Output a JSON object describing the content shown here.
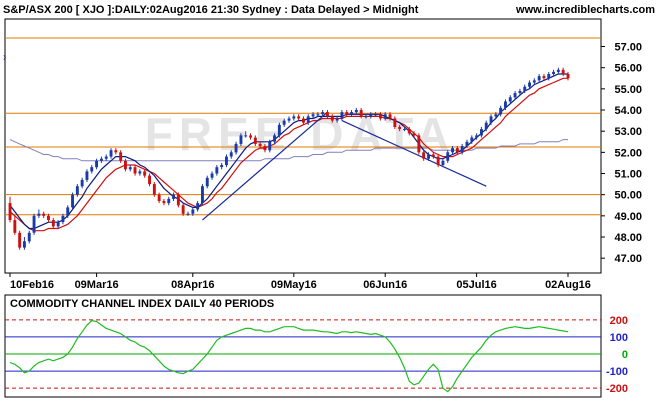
{
  "header": {
    "title": "S&P/ASX 200 [ XJO ]:DAILY:02Aug2016 21:30 Sydney : Data Delayed > Midnight",
    "site": "www.incrediblecharts.com",
    "watermark": "FREE DATA"
  },
  "colors": {
    "up_candle": "#1a3aaa",
    "down_candle": "#cc1111",
    "ma_short": "#0a1a80",
    "ma_medium": "#d01010",
    "ma_long": "#8080c0",
    "support_resistance": "#e07800",
    "trendline": "#1a2a99",
    "cci_line": "#22bb22",
    "cci_ref": "#2222cc",
    "cci_extreme": "#cc1111",
    "cci_zero": "#00aa00"
  },
  "chart_data": [
    {
      "type": "candlestick",
      "ylim": [
        46.3,
        58.3
      ],
      "yticks": [
        "47.00",
        "48.00",
        "49.00",
        "50.00",
        "51.00",
        "52.00",
        "53.00",
        "54.00",
        "55.00",
        "56.00",
        "57.00"
      ],
      "xlabels": [
        "10Feb16",
        "09Mar16",
        "08Apr16",
        "09May16",
        "06Jun16",
        "05Jul16",
        "02Aug16"
      ],
      "xlabel_index": [
        0,
        18,
        38,
        59,
        78,
        97,
        116
      ],
      "horizontal_lines": [
        57.4,
        53.85,
        52.25,
        50.0,
        49.05
      ],
      "trendlines": [
        {
          "from": [
            40,
            48.8
          ],
          "to": [
            66,
            53.9
          ]
        },
        {
          "from": [
            69,
            53.5
          ],
          "to": [
            99,
            50.4
          ]
        }
      ],
      "open": [
        49.6,
        48.8,
        48.2,
        47.5,
        47.8,
        48.2,
        49.0,
        49.1,
        49.0,
        48.8,
        48.5,
        48.7,
        49.0,
        49.4,
        50.0,
        50.4,
        50.7,
        51.1,
        51.3,
        51.6,
        51.7,
        51.8,
        52.1,
        52.0,
        51.6,
        51.2,
        51.3,
        51.0,
        51.1,
        50.9,
        50.5,
        50.0,
        49.7,
        49.6,
        49.8,
        50.0,
        49.5,
        49.1,
        49.1,
        49.3,
        49.6,
        50.4,
        50.8,
        51.0,
        51.3,
        51.4,
        51.8,
        52.0,
        52.4,
        52.8,
        52.8,
        52.7,
        52.4,
        52.3,
        52.1,
        52.5,
        52.8,
        53.3,
        53.5,
        53.6,
        53.7,
        53.6,
        53.4,
        53.7,
        53.8,
        53.8,
        53.9,
        53.7,
        53.5,
        53.6,
        53.9,
        53.8,
        53.9,
        54.0,
        53.7,
        53.7,
        53.8,
        53.8,
        53.6,
        53.8,
        53.6,
        53.2,
        53.1,
        53.1,
        52.9,
        52.8,
        52.0,
        51.7,
        51.9,
        51.8,
        51.4,
        51.6,
        52.0,
        52.2,
        52.0,
        52.3,
        52.5,
        52.7,
        52.8,
        53.1,
        53.4,
        53.7,
        53.8,
        54.1,
        54.4,
        54.6,
        54.8,
        54.9,
        55.1,
        55.3,
        55.4,
        55.6,
        55.5,
        55.7,
        55.8,
        55.9,
        55.7
      ],
      "close": [
        48.8,
        48.2,
        47.5,
        47.8,
        48.2,
        49.0,
        49.1,
        49.0,
        48.8,
        48.5,
        48.7,
        49.0,
        49.4,
        50.0,
        50.4,
        50.7,
        51.1,
        51.3,
        51.6,
        51.7,
        51.8,
        52.1,
        52.0,
        51.6,
        51.2,
        51.3,
        51.0,
        51.1,
        50.9,
        50.5,
        50.0,
        49.7,
        49.6,
        49.8,
        50.0,
        49.5,
        49.1,
        49.1,
        49.3,
        49.6,
        50.4,
        50.8,
        51.0,
        51.3,
        51.4,
        51.8,
        52.0,
        52.4,
        52.8,
        52.8,
        52.7,
        52.4,
        52.3,
        52.1,
        52.5,
        52.8,
        53.3,
        53.5,
        53.6,
        53.7,
        53.6,
        53.4,
        53.7,
        53.8,
        53.8,
        53.9,
        53.7,
        53.5,
        53.6,
        53.9,
        53.8,
        53.9,
        54.0,
        53.7,
        53.7,
        53.8,
        53.8,
        53.6,
        53.8,
        53.6,
        53.2,
        53.1,
        53.1,
        52.9,
        52.8,
        52.0,
        51.7,
        51.9,
        51.8,
        51.4,
        51.6,
        52.0,
        52.2,
        52.0,
        52.3,
        52.5,
        52.7,
        52.8,
        53.1,
        53.4,
        53.7,
        53.8,
        54.1,
        54.4,
        54.6,
        54.8,
        54.9,
        55.1,
        55.3,
        55.4,
        55.6,
        55.5,
        55.7,
        55.8,
        55.9,
        55.7,
        55.5
      ],
      "high": [
        49.9,
        49.0,
        48.3,
        48.0,
        48.3,
        49.1,
        49.3,
        49.2,
        49.1,
        48.9,
        48.8,
        49.1,
        49.5,
        50.1,
        50.5,
        50.8,
        51.2,
        51.4,
        51.7,
        51.8,
        51.9,
        52.2,
        52.2,
        52.1,
        51.7,
        51.4,
        51.4,
        51.2,
        51.2,
        51.0,
        50.6,
        50.1,
        49.8,
        49.9,
        50.1,
        50.1,
        49.6,
        49.2,
        49.4,
        49.7,
        50.5,
        50.9,
        51.1,
        51.4,
        51.5,
        51.9,
        52.1,
        52.5,
        52.9,
        53.0,
        52.9,
        52.8,
        52.5,
        52.4,
        52.6,
        52.9,
        53.4,
        53.6,
        53.7,
        53.8,
        53.8,
        53.7,
        53.8,
        53.9,
        53.9,
        54.0,
        54.0,
        53.8,
        53.7,
        54.0,
        54.0,
        54.0,
        54.1,
        54.1,
        53.8,
        53.9,
        53.9,
        53.9,
        53.9,
        53.9,
        53.7,
        53.3,
        53.2,
        53.2,
        53.0,
        52.9,
        52.1,
        52.0,
        52.0,
        51.9,
        51.7,
        52.1,
        52.3,
        52.3,
        52.4,
        52.6,
        52.8,
        52.9,
        53.2,
        53.5,
        53.8,
        53.9,
        54.2,
        54.5,
        54.7,
        54.9,
        55.0,
        55.2,
        55.4,
        55.5,
        55.7,
        55.7,
        55.8,
        55.9,
        56.0,
        56.0,
        55.8
      ],
      "low": [
        48.7,
        48.1,
        47.4,
        47.4,
        47.7,
        48.1,
        48.9,
        48.9,
        48.7,
        48.4,
        48.4,
        48.6,
        48.9,
        49.3,
        49.9,
        50.3,
        50.6,
        51.0,
        51.2,
        51.5,
        51.6,
        51.7,
        51.9,
        51.5,
        51.1,
        51.1,
        50.9,
        50.9,
        50.8,
        50.4,
        49.9,
        49.6,
        49.5,
        49.5,
        49.7,
        49.4,
        49.0,
        49.0,
        49.0,
        49.2,
        49.5,
        50.3,
        50.7,
        50.9,
        51.2,
        51.3,
        51.7,
        51.9,
        52.3,
        52.7,
        52.6,
        52.3,
        52.2,
        52.0,
        52.0,
        52.4,
        52.7,
        53.2,
        53.4,
        53.5,
        53.5,
        53.3,
        53.3,
        53.6,
        53.7,
        53.7,
        53.6,
        53.4,
        53.4,
        53.5,
        53.7,
        53.7,
        53.8,
        53.6,
        53.6,
        53.6,
        53.7,
        53.5,
        53.5,
        53.5,
        53.1,
        53.0,
        53.0,
        52.8,
        52.7,
        51.9,
        51.6,
        51.6,
        51.7,
        51.3,
        51.3,
        51.5,
        51.9,
        51.9,
        51.9,
        52.2,
        52.4,
        52.6,
        52.7,
        53.0,
        53.3,
        53.6,
        53.7,
        54.0,
        54.3,
        54.5,
        54.7,
        54.8,
        55.0,
        55.2,
        55.3,
        55.4,
        55.4,
        55.6,
        55.7,
        55.6,
        55.4
      ],
      "ma_short": [
        49.5,
        49.2,
        48.9,
        48.6,
        48.4,
        48.4,
        48.5,
        48.6,
        48.7,
        48.7,
        48.7,
        48.8,
        49.0,
        49.3,
        49.6,
        49.9,
        50.3,
        50.6,
        50.9,
        51.2,
        51.4,
        51.6,
        51.8,
        51.8,
        51.8,
        51.7,
        51.6,
        51.4,
        51.3,
        51.1,
        50.9,
        50.6,
        50.3,
        50.1,
        49.9,
        49.8,
        49.6,
        49.5,
        49.4,
        49.4,
        49.6,
        49.8,
        50.1,
        50.4,
        50.7,
        51.0,
        51.3,
        51.6,
        51.9,
        52.2,
        52.4,
        52.5,
        52.5,
        52.5,
        52.5,
        52.6,
        52.8,
        53.0,
        53.2,
        53.4,
        53.5,
        53.5,
        53.6,
        53.6,
        53.7,
        53.7,
        53.7,
        53.7,
        53.7,
        53.7,
        53.8,
        53.8,
        53.8,
        53.8,
        53.8,
        53.8,
        53.8,
        53.8,
        53.7,
        53.6,
        53.5,
        53.4,
        53.2,
        53.0,
        52.7,
        52.4,
        52.1,
        51.9,
        51.8,
        51.7,
        51.7,
        51.8,
        51.9,
        52.0,
        52.1,
        52.3,
        52.5,
        52.7,
        52.9,
        53.1,
        53.4,
        53.6,
        53.9,
        54.1,
        54.3,
        54.5,
        54.7,
        54.9,
        55.0,
        55.2,
        55.3,
        55.4,
        55.5,
        55.6,
        55.7,
        55.7,
        55.7
      ],
      "ma_medium": [
        49.2,
        49.0,
        48.8,
        48.6,
        48.4,
        48.3,
        48.3,
        48.3,
        48.4,
        48.4,
        48.4,
        48.5,
        48.6,
        48.8,
        49.0,
        49.3,
        49.6,
        49.9,
        50.2,
        50.5,
        50.8,
        51.0,
        51.2,
        51.3,
        51.4,
        51.4,
        51.4,
        51.3,
        51.2,
        51.1,
        51.0,
        50.8,
        50.6,
        50.4,
        50.2,
        50.0,
        49.8,
        49.6,
        49.5,
        49.4,
        49.5,
        49.6,
        49.8,
        50.1,
        50.3,
        50.6,
        50.9,
        51.2,
        51.5,
        51.7,
        51.9,
        52.1,
        52.2,
        52.2,
        52.3,
        52.4,
        52.6,
        52.8,
        52.9,
        53.1,
        53.2,
        53.3,
        53.4,
        53.5,
        53.5,
        53.6,
        53.6,
        53.6,
        53.6,
        53.6,
        53.7,
        53.7,
        53.7,
        53.7,
        53.7,
        53.7,
        53.7,
        53.7,
        53.6,
        53.6,
        53.5,
        53.4,
        53.3,
        53.1,
        52.9,
        52.7,
        52.4,
        52.2,
        52.0,
        51.9,
        51.8,
        51.8,
        51.8,
        51.9,
        52.0,
        52.1,
        52.2,
        52.4,
        52.6,
        52.8,
        53.0,
        53.2,
        53.4,
        53.7,
        53.9,
        54.1,
        54.3,
        54.5,
        54.7,
        54.8,
        55.0,
        55.1,
        55.2,
        55.3,
        55.4,
        55.5,
        55.5
      ],
      "ma_long": [
        52.6,
        52.5,
        52.4,
        52.3,
        52.2,
        52.1,
        52.0,
        51.9,
        51.9,
        51.8,
        51.8,
        51.7,
        51.7,
        51.7,
        51.7,
        51.6,
        51.6,
        51.6,
        51.6,
        51.6,
        51.6,
        51.6,
        51.6,
        51.6,
        51.6,
        51.6,
        51.6,
        51.6,
        51.6,
        51.6,
        51.6,
        51.6,
        51.6,
        51.6,
        51.6,
        51.6,
        51.6,
        51.6,
        51.6,
        51.6,
        51.6,
        51.6,
        51.6,
        51.6,
        51.6,
        51.6,
        51.6,
        51.6,
        51.6,
        51.6,
        51.6,
        51.6,
        51.6,
        51.7,
        51.7,
        51.7,
        51.7,
        51.7,
        51.7,
        51.8,
        51.8,
        51.8,
        51.8,
        51.9,
        51.9,
        51.9,
        52.0,
        52.0,
        52.0,
        52.0,
        52.1,
        52.1,
        52.1,
        52.1,
        52.1,
        52.1,
        52.2,
        52.2,
        52.2,
        52.2,
        52.2,
        52.2,
        52.2,
        52.2,
        52.2,
        52.2,
        52.2,
        52.2,
        52.1,
        52.1,
        52.1,
        52.1,
        52.1,
        52.1,
        52.1,
        52.1,
        52.1,
        52.2,
        52.2,
        52.2,
        52.2,
        52.2,
        52.3,
        52.3,
        52.3,
        52.3,
        52.4,
        52.4,
        52.4,
        52.4,
        52.5,
        52.5,
        52.5,
        52.5,
        52.5,
        52.6,
        52.6
      ]
    },
    {
      "type": "line",
      "title": "COMMODITY CHANNEL INDEX DAILY 40 PERIODS",
      "ylim": [
        -240,
        240
      ],
      "yticks": [
        200,
        100,
        0,
        -100,
        -200
      ],
      "ytick_labels": [
        "200",
        "100",
        "0",
        "-100",
        "-200"
      ],
      "reference_lines": [
        200,
        100,
        0,
        -100,
        -200
      ],
      "values": [
        -50,
        -60,
        -80,
        -110,
        -100,
        -70,
        -50,
        -40,
        -30,
        -40,
        -30,
        -20,
        0,
        40,
        90,
        130,
        170,
        195,
        190,
        170,
        150,
        140,
        130,
        120,
        100,
        80,
        70,
        50,
        40,
        20,
        -10,
        -40,
        -70,
        -90,
        -100,
        -110,
        -115,
        -100,
        -90,
        -60,
        -30,
        0,
        40,
        80,
        100,
        110,
        120,
        130,
        140,
        150,
        150,
        140,
        140,
        130,
        130,
        140,
        150,
        160,
        160,
        160,
        150,
        140,
        140,
        140,
        135,
        130,
        130,
        125,
        120,
        130,
        130,
        125,
        130,
        125,
        120,
        115,
        120,
        110,
        100,
        70,
        30,
        -20,
        -80,
        -160,
        -180,
        -170,
        -130,
        -90,
        -60,
        -90,
        -200,
        -220,
        -190,
        -140,
        -100,
        -60,
        -20,
        10,
        40,
        80,
        110,
        130,
        140,
        150,
        155,
        160,
        155,
        150,
        150,
        155,
        160,
        155,
        150,
        145,
        140,
        135,
        130
      ]
    }
  ]
}
